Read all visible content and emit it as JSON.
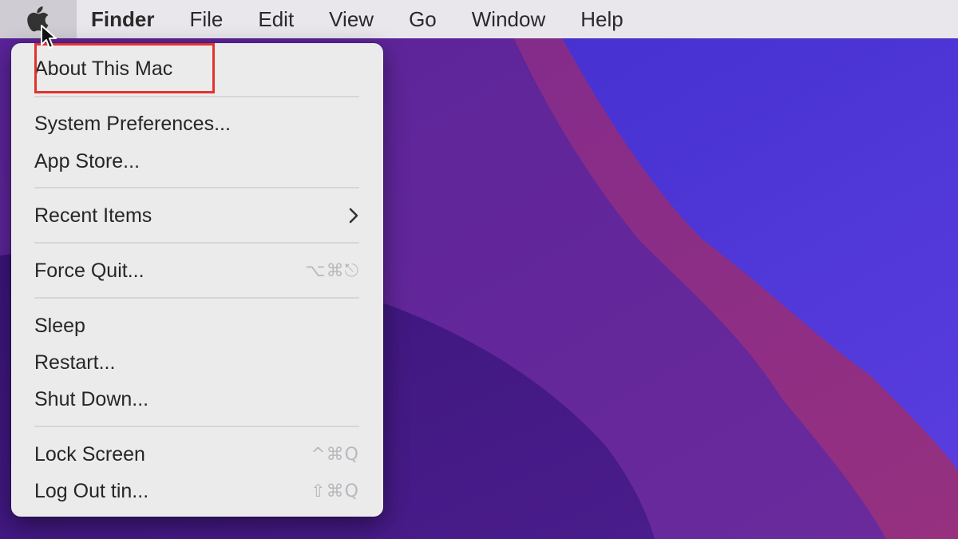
{
  "menubar": {
    "apple_icon": "apple-logo-icon",
    "items": [
      "Finder",
      "File",
      "Edit",
      "View",
      "Go",
      "Window",
      "Help"
    ]
  },
  "apple_menu": {
    "about": "About This Mac",
    "system_preferences": "System Preferences...",
    "app_store": "App Store...",
    "recent_items": "Recent Items",
    "recent_items_icon": "chevron-right-icon",
    "force_quit": "Force Quit...",
    "force_quit_shortcut": "⌥⌘⎋",
    "sleep": "Sleep",
    "restart": "Restart...",
    "shut_down": "Shut Down...",
    "lock_screen": "Lock Screen",
    "lock_screen_shortcut": "^⌘Q",
    "log_out": "Log Out tin...",
    "log_out_shortcut": "⇧⌘Q"
  },
  "colors": {
    "menubar": "#e9e7ec",
    "menu_background": "#ebebec",
    "highlight_box": "#e5312d",
    "wallpaper_dark": "#3c1a86",
    "wallpaper_blue": "#4b35d6",
    "wallpaper_magenta": "#8a2a8e"
  }
}
